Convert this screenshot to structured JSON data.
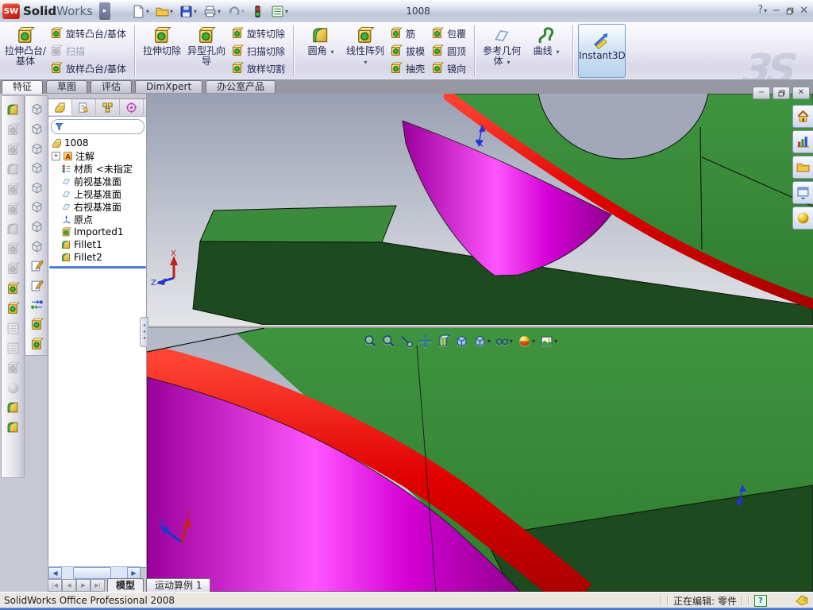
{
  "titlebar": {
    "logo_badge": "SW",
    "logo_solid": "Solid",
    "logo_works": "Works",
    "title": "1008",
    "help": "?"
  },
  "ribbon": {
    "watermark": "3S",
    "groups": [
      {
        "items": [
          {
            "label": "拉伸凸台/基体"
          },
          {
            "label": "旋转凸台/基体"
          },
          {
            "label": "扫描",
            "disabled": true
          },
          {
            "label": "放样凸台/基体"
          }
        ]
      },
      {
        "items": [
          {
            "label": "拉伸切除"
          },
          {
            "label": "异型孔向导"
          },
          {
            "label": "旋转切除"
          },
          {
            "label": "扫描切除"
          },
          {
            "label": "放样切割"
          }
        ]
      },
      {
        "items": [
          {
            "label": "圆角",
            "dropdown": true
          },
          {
            "label": "线性阵列",
            "dropdown": true
          },
          {
            "label": "筋"
          },
          {
            "label": "拔模"
          },
          {
            "label": "抽壳"
          },
          {
            "label": "包覆"
          },
          {
            "label": "圆顶"
          },
          {
            "label": "镜向"
          }
        ]
      },
      {
        "items": [
          {
            "label": "参考几何体",
            "dropdown": true
          },
          {
            "label": "曲线",
            "dropdown": true
          }
        ]
      },
      {
        "items": [
          {
            "label": "Instant3D",
            "active": true
          }
        ]
      }
    ]
  },
  "command_tabs": {
    "items": [
      "特征",
      "草图",
      "评估",
      "DimXpert",
      "办公室产品"
    ],
    "active": "特征"
  },
  "feature_panel": {
    "filter_placeholder": "",
    "tree": [
      {
        "label": "1008"
      },
      {
        "label": "注解"
      },
      {
        "label": "材质 <未指定"
      },
      {
        "label": "前视基准面"
      },
      {
        "label": "上视基准面"
      },
      {
        "label": "右视基准面"
      },
      {
        "label": "原点"
      },
      {
        "label": "Imported1"
      },
      {
        "label": "Fillet1"
      },
      {
        "label": "Fillet2"
      }
    ]
  },
  "doc_tabs": {
    "model": "模型",
    "motion": "运动算例 1"
  },
  "statusbar": {
    "left": "SolidWorks Office Professional 2008",
    "editing": "正在编辑: 零件"
  },
  "viewport": {
    "triad_x": "X",
    "triad_z": "Z"
  },
  "colors": {
    "green": "#3c8b3c",
    "dark_green": "#1d4a1f",
    "magenta": "#d400d4",
    "red": "#dd0000",
    "accent_blue": "#3a6ea5"
  }
}
